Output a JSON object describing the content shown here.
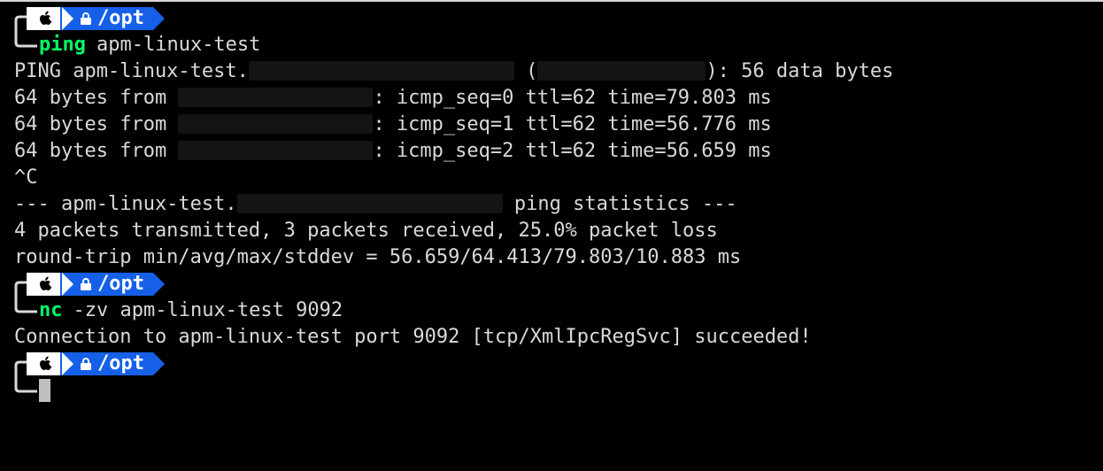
{
  "prompt": {
    "path_label": "/opt"
  },
  "cmd1": {
    "name": "ping",
    "args": "apm-linux-test"
  },
  "out": {
    "ping_header_pre": "PING apm-linux-test.",
    "ping_header_mid": " (",
    "ping_header_post": "): 56 data bytes",
    "line1_pre": "64 bytes from ",
    "line1_post": ": icmp_seq=0 ttl=62 time=79.803 ms",
    "line2_pre": "64 bytes from ",
    "line2_post": ": icmp_seq=1 ttl=62 time=56.776 ms",
    "line3_pre": "64 bytes from ",
    "line3_post": ": icmp_seq=2 ttl=62 time=56.659 ms",
    "ctrlc": "^C",
    "stats_pre": "--- apm-linux-test.",
    "stats_post": " ping statistics ---",
    "pkts": "4 packets transmitted, 3 packets received, 25.0% packet loss",
    "rtt": "round-trip min/avg/max/stddev = 56.659/64.413/79.803/10.883 ms"
  },
  "cmd2": {
    "name": "nc",
    "args": "-zv apm-linux-test 9092"
  },
  "out2": {
    "line": "Connection to apm-linux-test port 9092 [tcp/XmlIpcRegSvc] succeeded!"
  }
}
